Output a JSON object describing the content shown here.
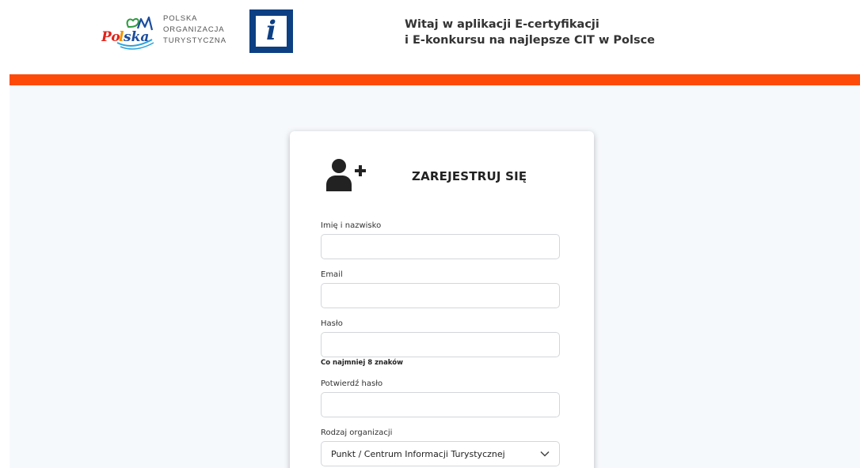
{
  "header": {
    "brand_logo": "polska-logo",
    "org_name": [
      "POLSKA",
      "ORGANIZACJA",
      "TURYSTYCZNA"
    ],
    "info_logo_icon": "info-i-icon",
    "welcome_line1": "Witaj w aplikacji E-certyfikacji",
    "welcome_line2": "i E-konkursu na najlepsze CIT w Polsce"
  },
  "colors": {
    "accent_bar": "#fe4a08",
    "info_logo": "#0d3f83",
    "page_background": "#f6f9fc"
  },
  "register_form": {
    "icon": "user-plus-icon",
    "title": "ZAREJESTRUJ SIĘ",
    "fields": {
      "full_name": {
        "label": "Imię i nazwisko",
        "value": "",
        "placeholder": ""
      },
      "email": {
        "label": "Email",
        "value": "",
        "placeholder": ""
      },
      "password": {
        "label": "Hasło",
        "value": "",
        "placeholder": "",
        "hint": "Co najmniej 8 znaków"
      },
      "confirm_password": {
        "label": "Potwierdź hasło",
        "value": "",
        "placeholder": ""
      },
      "organization_type": {
        "label": "Rodzaj organizacji",
        "selected": "Punkt / Centrum Informacji Turystycznej"
      }
    }
  }
}
